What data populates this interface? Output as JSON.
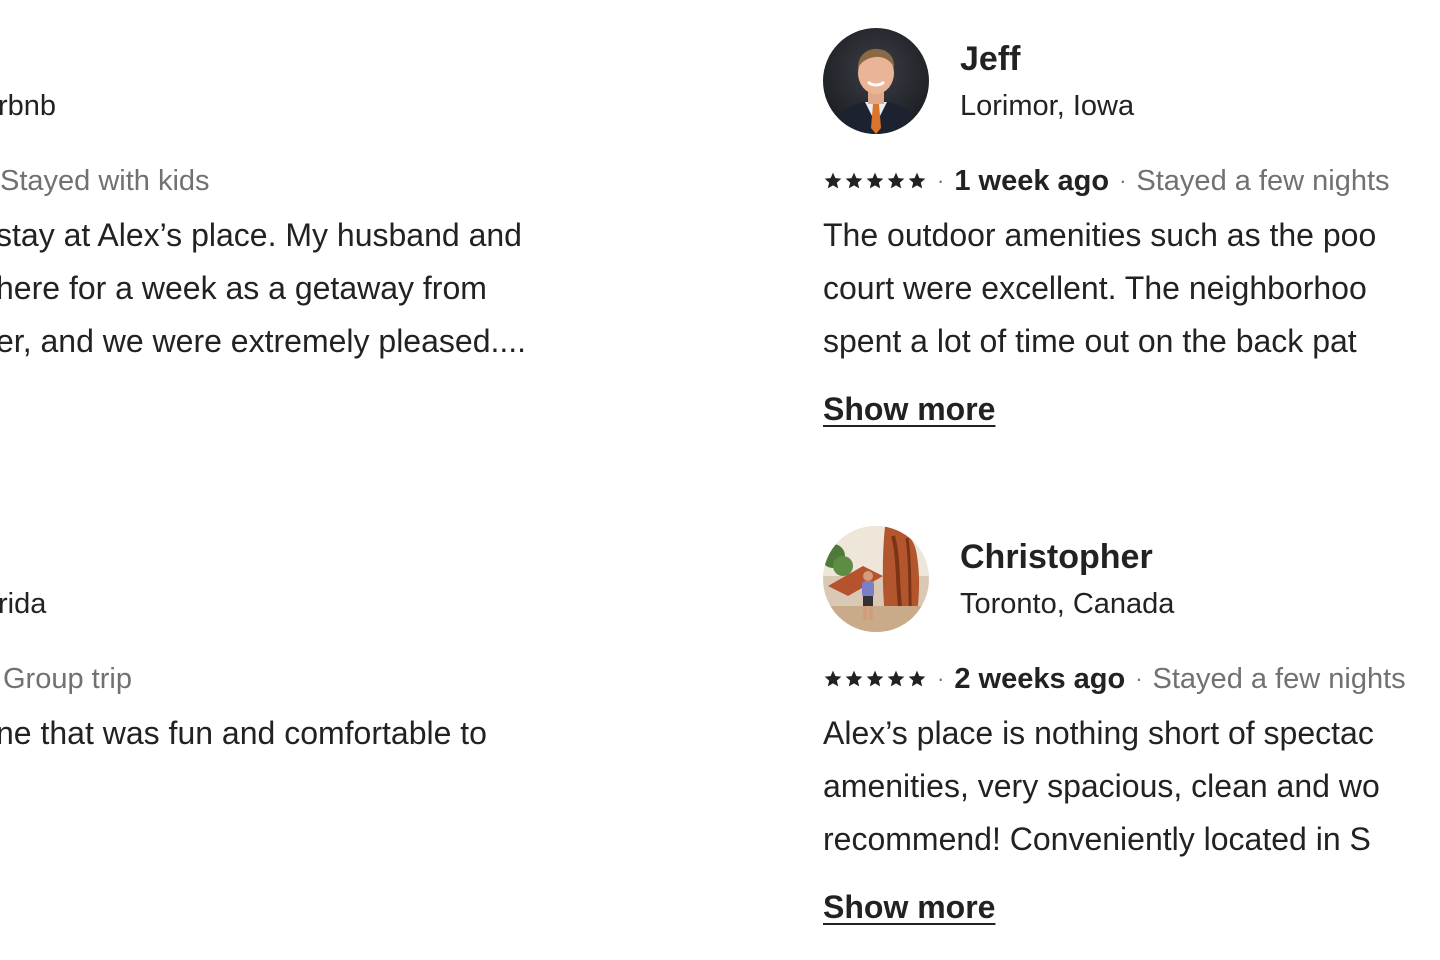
{
  "left_column": {
    "reviews": [
      {
        "location": "rbnb",
        "stay_type": "Stayed with kids",
        "body_lines": [
          "stay at Alex’s place. My husband and",
          "here for a week as a getaway from",
          "er, and we were extremely pleased...."
        ]
      },
      {
        "location": "rida",
        "stay_type": "Group trip",
        "body_lines": [
          "ne that was fun and comfortable to"
        ]
      }
    ]
  },
  "right_column": {
    "reviews": [
      {
        "name": "Jeff",
        "location": "Lorimor, Iowa",
        "rating": 5,
        "date": "1 week ago",
        "separator": "·",
        "stay_type": "Stayed a few nights",
        "body_lines": [
          "The outdoor amenities such as the poo",
          "court were excellent. The neighborhoo",
          "spent a lot of time out on the back pat"
        ],
        "show_more_label": "Show more"
      },
      {
        "name": "Christopher",
        "location": "Toronto, Canada",
        "rating": 5,
        "date": "2 weeks ago",
        "separator": "·",
        "stay_type": "Stayed a few nights",
        "body_lines": [
          "Alex’s place is nothing short of spectac",
          "amenities, very spacious, clean and wo",
          "recommend! Conveniently located in S"
        ],
        "show_more_label": "Show more"
      }
    ]
  },
  "colors": {
    "text_primary": "#222222",
    "text_secondary": "#717171",
    "background": "#ffffff"
  },
  "icons": {
    "star": "star-icon",
    "avatar_jeff": "profile-photo",
    "avatar_christopher": "profile-photo"
  }
}
